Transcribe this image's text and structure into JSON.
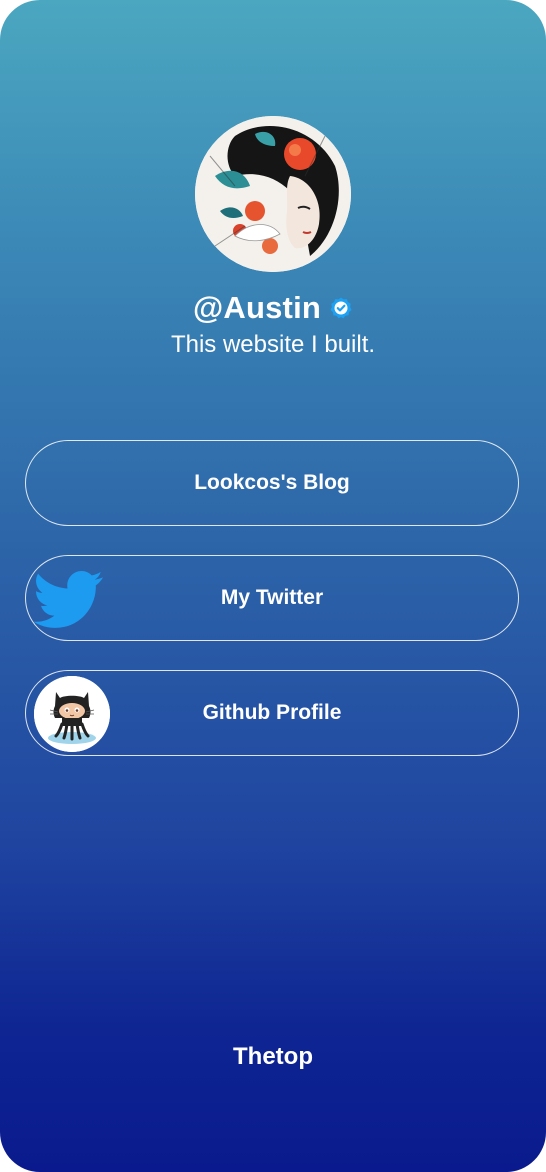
{
  "profile": {
    "username": "@Austin",
    "tagline": "This website I built.",
    "avatar_icon": "illustrated-portrait-avatar",
    "verified_icon": "verified-badge-icon",
    "verified_color": "#1da1f2"
  },
  "links": [
    {
      "label": "Lookcos's Blog",
      "icon": null
    },
    {
      "label": "My Twitter",
      "icon": "twitter-bird-icon",
      "icon_color": "#1d9bf0"
    },
    {
      "label": "Github Profile",
      "icon": "github-octocat-icon"
    }
  ],
  "footer": {
    "text": "Thetop"
  },
  "colors": {
    "gradient_top": "#4ba7c0",
    "gradient_bottom": "#0a1a8e",
    "text": "#ffffff"
  }
}
